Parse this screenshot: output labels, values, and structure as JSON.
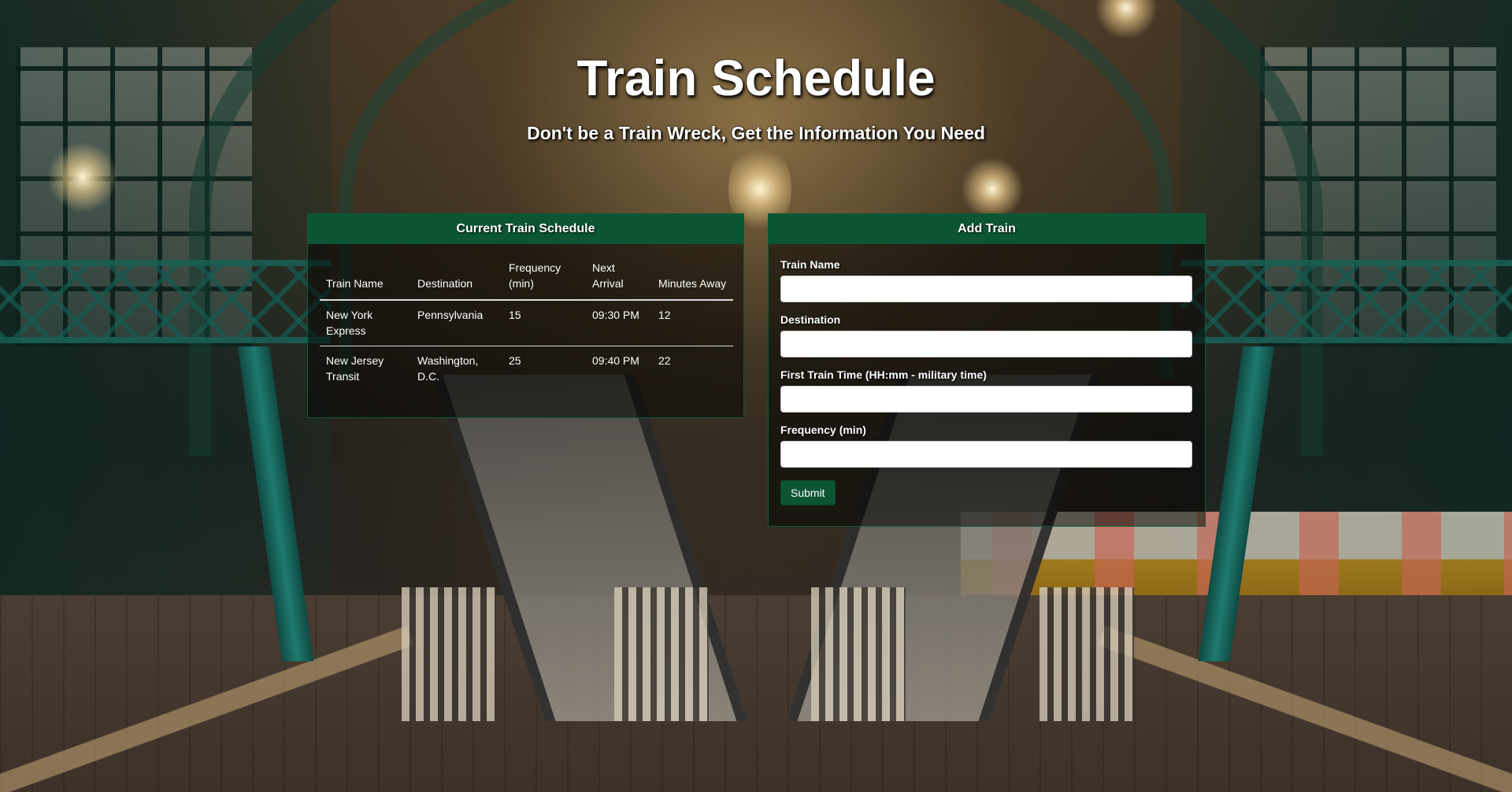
{
  "header": {
    "title": "Train Schedule",
    "subtitle": "Don't be a Train Wreck, Get the Information You Need"
  },
  "schedule": {
    "heading": "Current Train Schedule",
    "columns": [
      "Train Name",
      "Destination",
      "Frequency (min)",
      "Next Arrival",
      "Minutes Away"
    ],
    "rows": [
      [
        "New York Express",
        "Pennsylvania",
        "15",
        "09:30 PM",
        "12"
      ],
      [
        "New Jersey Transit",
        "Washington, D.C.",
        "25",
        "09:40 PM",
        "22"
      ]
    ]
  },
  "add_train": {
    "heading": "Add Train",
    "fields": [
      {
        "label": "Train Name",
        "value": ""
      },
      {
        "label": "Destination",
        "value": ""
      },
      {
        "label": "First Train Time (HH:mm - military time)",
        "value": ""
      },
      {
        "label": "Frequency (min)",
        "value": ""
      }
    ],
    "submit_label": "Submit"
  },
  "colors": {
    "panel_header": "#0b5534",
    "button": "#0b5534"
  }
}
